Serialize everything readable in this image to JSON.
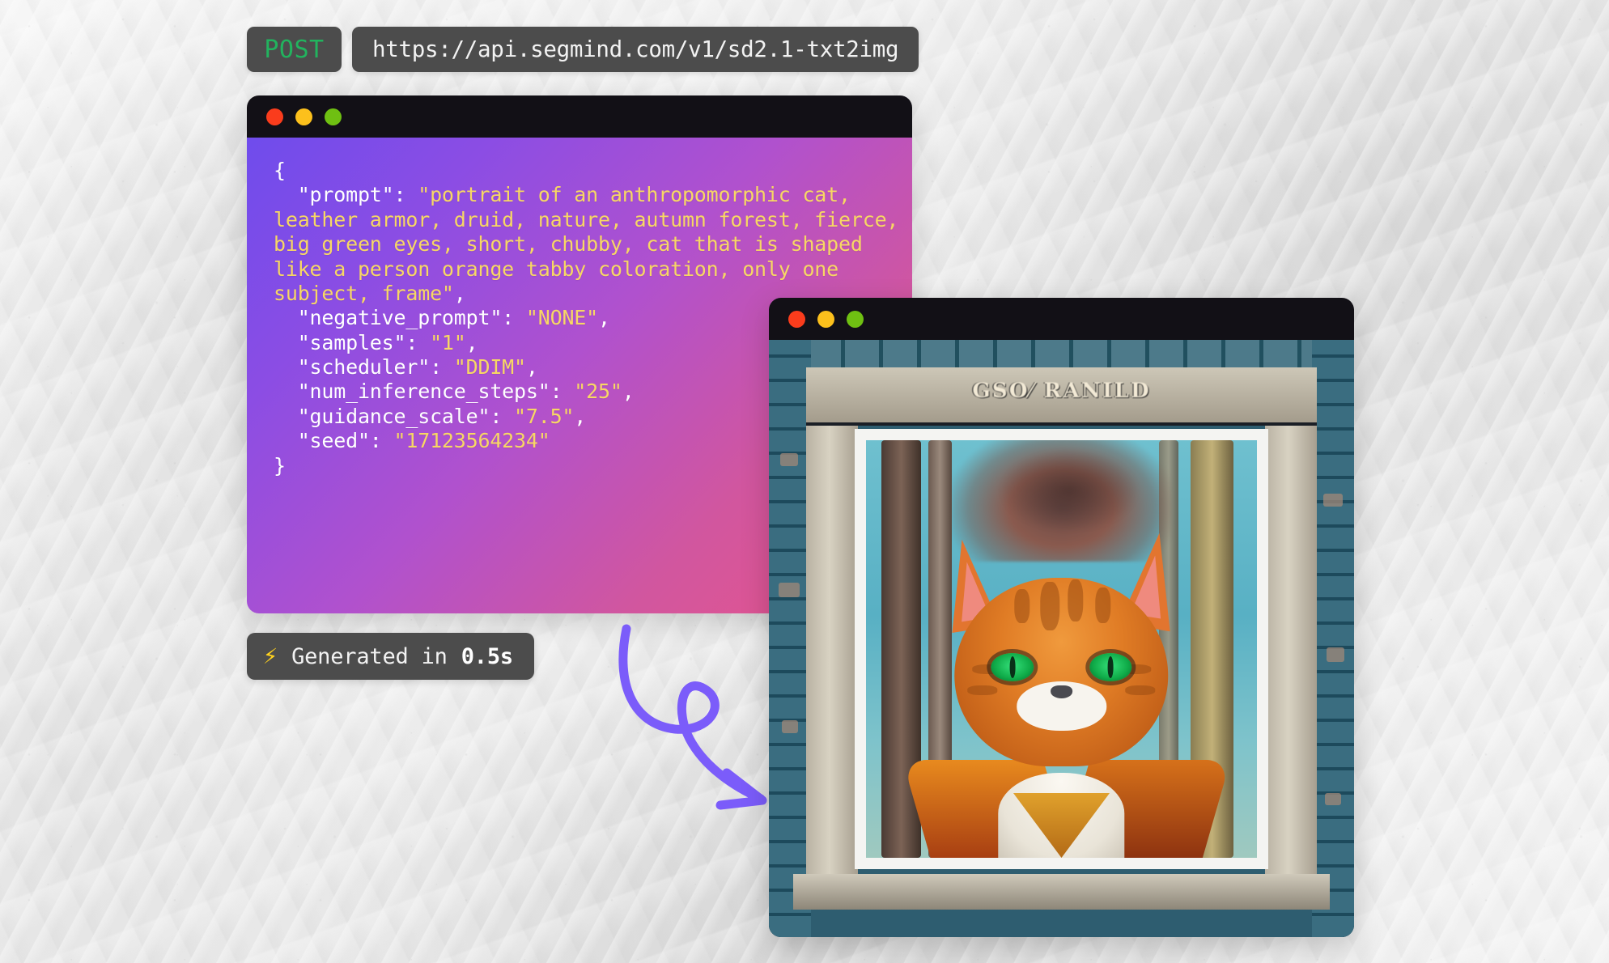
{
  "request": {
    "method": "POST",
    "url": "https://api.segmind.com/v1/sd2.1-txt2img"
  },
  "code_window": {
    "traffic_lights": [
      "close-red",
      "minimize-amber",
      "maximize-green"
    ],
    "payload": {
      "prompt": "portrait of an anthropomorphic cat, leather armor, druid, nature, autumn forest, fierce, big green eyes, short, chubby, cat that is shaped like a person orange tabby coloration, only one subject, frame",
      "negative_prompt": "NONE",
      "samples": "1",
      "scheduler": "DDIM",
      "num_inference_steps": "25",
      "guidance_scale": "7.5",
      "seed": "17123564234"
    },
    "rendered_lines": [
      {
        "plain": "{"
      },
      {
        "plain": "  \"prompt\": ",
        "string": "\"portrait of an anthropomorphic cat, leather armor, druid, nature, autumn forest, fierce, big green eyes, short, chubby, cat that is shaped like a person orange tabby coloration, only one subject, frame\"",
        "trail": ","
      },
      {
        "plain": "  \"negative_prompt\": ",
        "string": "\"NONE\"",
        "trail": ","
      },
      {
        "plain": "  \"samples\": ",
        "string": "\"1\"",
        "trail": ","
      },
      {
        "plain": "  \"scheduler\": ",
        "string": "\"DDIM\"",
        "trail": ","
      },
      {
        "plain": "  \"num_inference_steps\": ",
        "string": "\"25\"",
        "trail": ","
      },
      {
        "plain": "  \"guidance_scale\": ",
        "string": "\"7.5\"",
        "trail": ","
      },
      {
        "plain": "  \"seed\": ",
        "string": "\"17123564234\"",
        "trail": ""
      },
      {
        "plain": "}"
      }
    ]
  },
  "status_badge": {
    "icon": "lightning-bolt-icon",
    "bolt_glyph": "⚡",
    "label": "Generated in",
    "time": "0.5s"
  },
  "arrow": {
    "name": "curved-flow-arrow",
    "color": "#7b5cfa"
  },
  "image_window": {
    "traffic_lights": [
      "close-red",
      "minimize-amber",
      "maximize-green"
    ],
    "plaque_text": "GSO⁄ RANILD",
    "subject": "anthropomorphic orange tabby cat in leather armor inside a stone frame"
  },
  "colors": {
    "method_accent": "#22b35e",
    "pill_background": "#4c4c4c",
    "titlebar": "#121016",
    "code_gradient_start": "#6f4cec",
    "code_gradient_end": "#ea5489",
    "string_yellow": "#f7d764",
    "key_white": "#ffffff",
    "bolt_yellow": "#ffd21e",
    "arrow_purple": "#7b5cfa",
    "traffic_red": "#fa3c1c",
    "traffic_amber": "#fcc01c",
    "traffic_green": "#6fc012",
    "page_background": "#efefef"
  }
}
